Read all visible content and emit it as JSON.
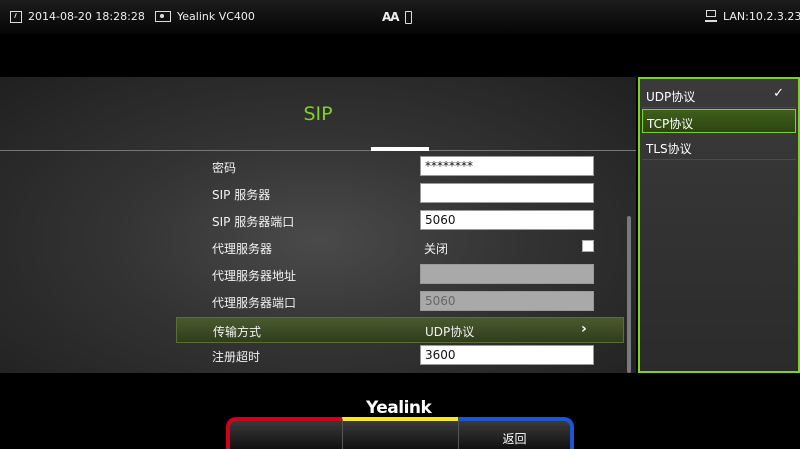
{
  "status_bar": {
    "datetime": "2014-08-20 18:28:28",
    "device": "Yealink VC400",
    "lan": "LAN:10.2.3.234"
  },
  "page": {
    "title": "SIP"
  },
  "form": {
    "password": {
      "label": "密码",
      "value": "********"
    },
    "sip_server": {
      "label": "SIP 服务器",
      "value": ""
    },
    "sip_server_port": {
      "label": "SIP 服务器端口",
      "value": "5060"
    },
    "proxy_server": {
      "label": "代理服务器",
      "value": "关闭"
    },
    "proxy_address": {
      "label": "代理服务器地址",
      "value": ""
    },
    "proxy_port": {
      "label": "代理服务器端口",
      "value": "5060"
    },
    "transport": {
      "label": "传输方式",
      "value": "UDP协议"
    },
    "registration_timeout": {
      "label": "注册超时",
      "value": "3600"
    }
  },
  "dropdown": {
    "options": [
      {
        "label": "UDP协议",
        "selected": true
      },
      {
        "label": "TCP协议",
        "highlighted": true
      },
      {
        "label": "TLS协议"
      }
    ]
  },
  "footer": {
    "logo": "Yealink",
    "softkeys": [
      "",
      "",
      "返回"
    ]
  },
  "colors": {
    "accent_green": "#7ed321",
    "softkey_red": "#d0021b",
    "softkey_yellow": "#f8e71c",
    "softkey_blue": "#1a56d6"
  },
  "icons": [
    "clock-icon",
    "device-icon",
    "font-size-icon",
    "usb-icon",
    "network-icon",
    "chevron-right-icon",
    "checkmark-icon"
  ]
}
